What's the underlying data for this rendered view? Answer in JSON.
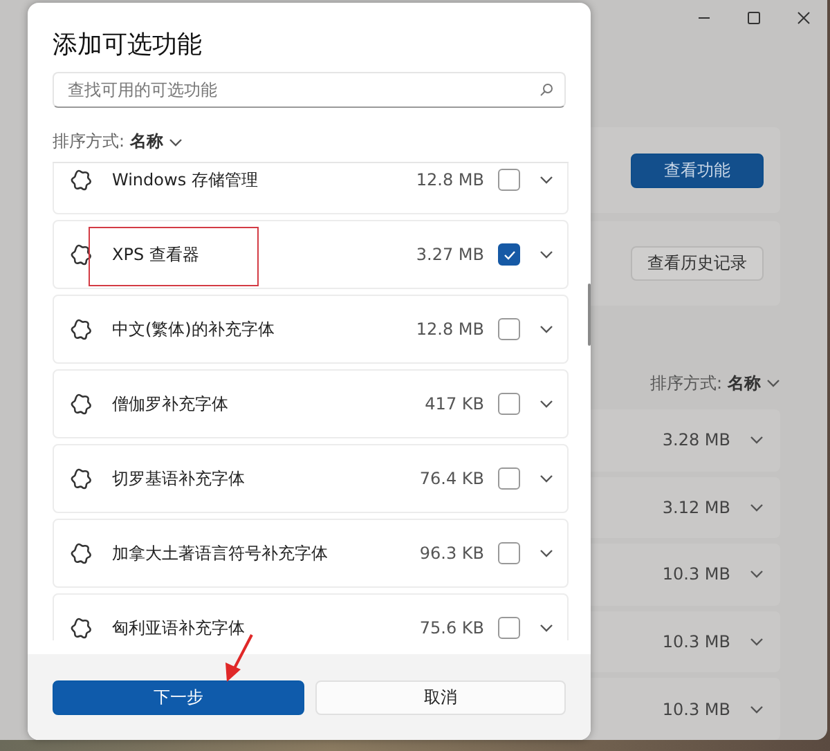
{
  "background_window": {
    "buttons": [
      {
        "label": "查看功能",
        "kind": "primary"
      },
      {
        "label": "查看历史记录",
        "kind": "secondary"
      }
    ],
    "sort": {
      "label": "排序方式:",
      "value": "名称"
    },
    "rows": [
      {
        "size": "3.28 MB"
      },
      {
        "size": "3.12 MB"
      },
      {
        "size": "10.3 MB"
      },
      {
        "size": "10.3 MB"
      },
      {
        "size": "10.3 MB"
      }
    ]
  },
  "dialog": {
    "title": "添加可选功能",
    "search": {
      "placeholder": "查找可用的可选功能"
    },
    "sort": {
      "label": "排序方式:",
      "value": "名称"
    },
    "features": [
      {
        "name": "Windows 存储管理",
        "size": "12.8 MB",
        "checked": false
      },
      {
        "name": "XPS 查看器",
        "size": "3.27 MB",
        "checked": true
      },
      {
        "name": "中文(繁体)的补充字体",
        "size": "12.8 MB",
        "checked": false
      },
      {
        "name": "僧伽罗补充字体",
        "size": "417 KB",
        "checked": false
      },
      {
        "name": "切罗基语补充字体",
        "size": "76.4 KB",
        "checked": false
      },
      {
        "name": "加拿大土著语言符号补充字体",
        "size": "96.3 KB",
        "checked": false
      },
      {
        "name": "匈利亚语补充字体",
        "size": "75.6 KB",
        "checked": false
      }
    ],
    "buttons": [
      {
        "label": "下一步",
        "kind": "primary"
      },
      {
        "label": "取消",
        "kind": "secondary"
      }
    ]
  }
}
